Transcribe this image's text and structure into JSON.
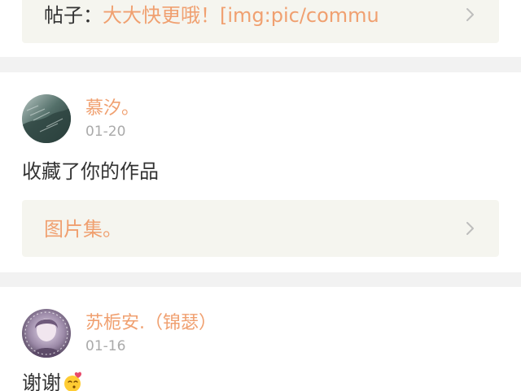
{
  "posts": [
    {
      "reference": {
        "label": "帖子：",
        "title": "大大快更哦！[img:pic/commu",
        "icon": "chevron-right-icon"
      }
    },
    {
      "username": "慕汐。",
      "date": "01-20",
      "comment": "收藏了你的作品",
      "reference": {
        "title": "图片集。",
        "icon": "chevron-right-icon"
      }
    },
    {
      "username": "苏栀安.（锦瑟）",
      "date": "01-16",
      "comment": "谢谢",
      "emoji": "kiss-emoji-icon"
    }
  ],
  "colors": {
    "accent": "#f0a070",
    "text": "#333333",
    "muted": "#aaaaaa",
    "ref_bg": "#f5f5ef",
    "page_bg": "#f2f2f2"
  }
}
